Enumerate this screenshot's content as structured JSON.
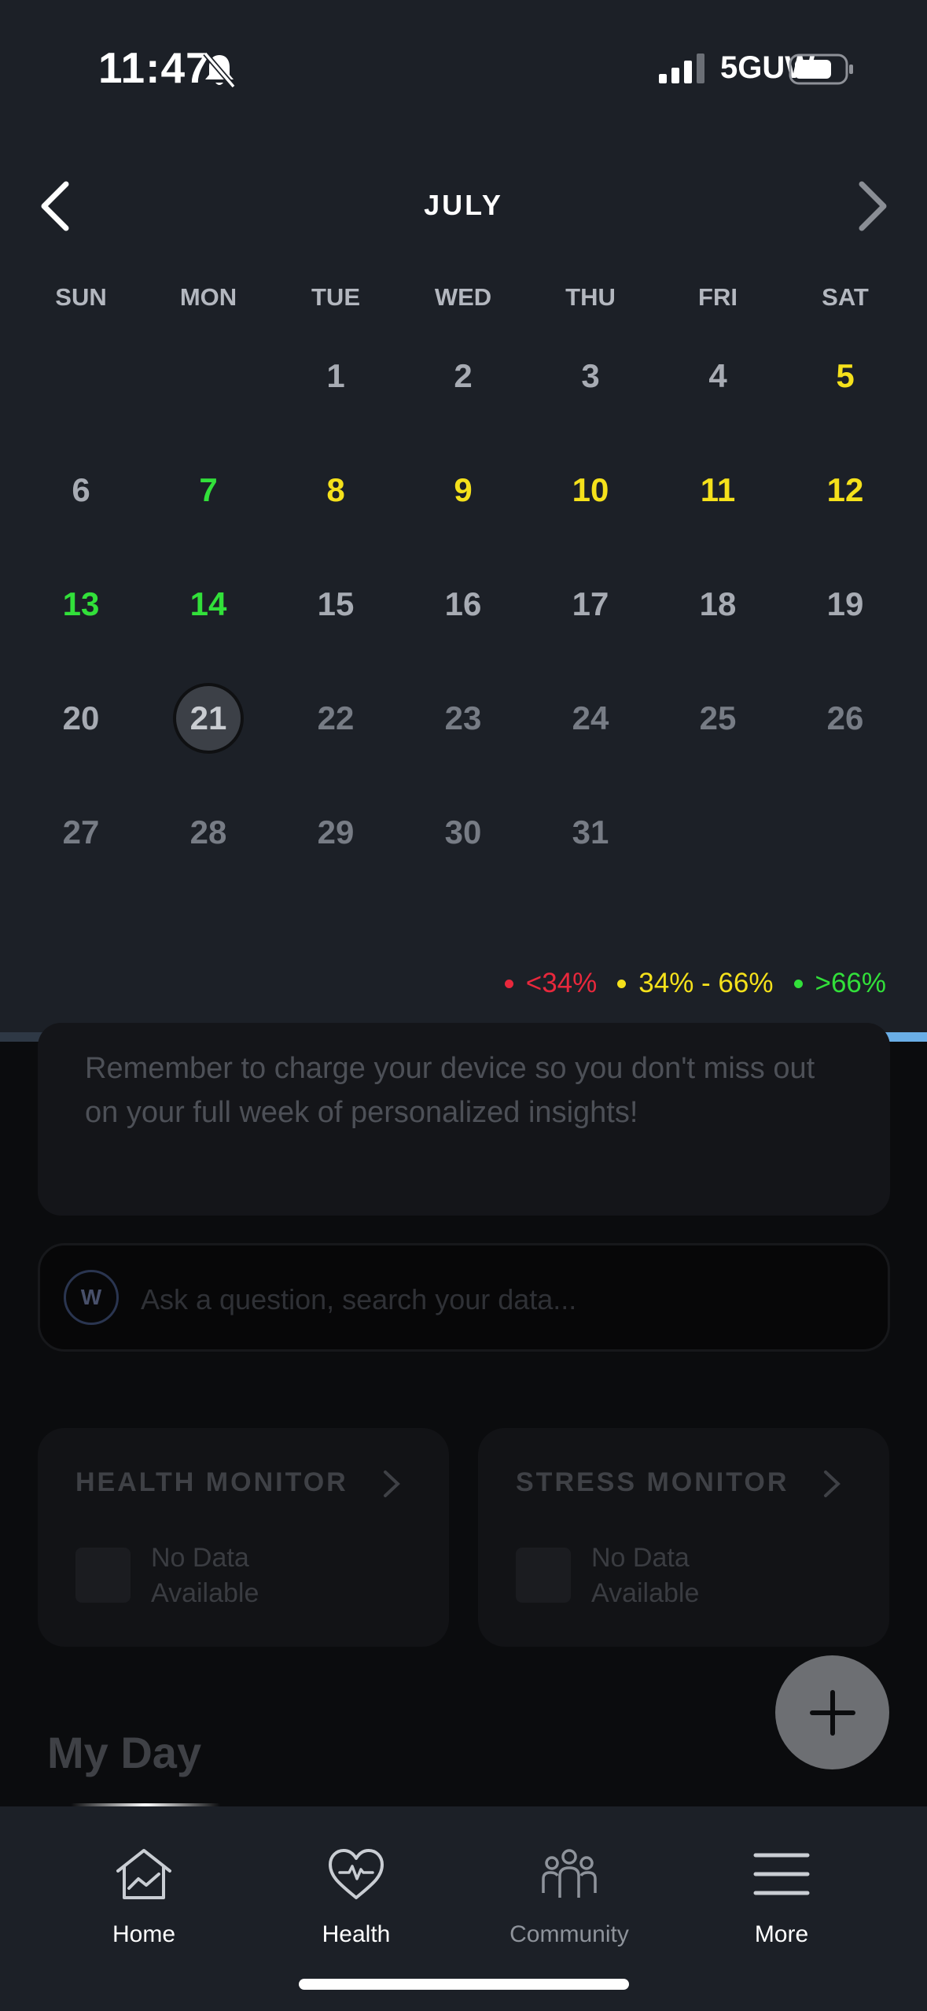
{
  "status_bar": {
    "time": "11:47",
    "network": "5GUW"
  },
  "calendar": {
    "month": "JULY",
    "weekdays": [
      "SUN",
      "MON",
      "TUE",
      "WED",
      "THU",
      "FRI",
      "SAT"
    ],
    "days": [
      {
        "d": "1",
        "s": "past"
      },
      {
        "d": "2",
        "s": "past"
      },
      {
        "d": "3",
        "s": "past"
      },
      {
        "d": "4",
        "s": "past"
      },
      {
        "d": "5",
        "s": "yellow"
      },
      {
        "d": "6",
        "s": "past"
      },
      {
        "d": "7",
        "s": "green"
      },
      {
        "d": "8",
        "s": "yellow"
      },
      {
        "d": "9",
        "s": "yellow"
      },
      {
        "d": "10",
        "s": "yellow"
      },
      {
        "d": "11",
        "s": "yellow"
      },
      {
        "d": "12",
        "s": "yellow"
      },
      {
        "d": "13",
        "s": "green"
      },
      {
        "d": "14",
        "s": "green"
      },
      {
        "d": "15",
        "s": "past"
      },
      {
        "d": "16",
        "s": "past"
      },
      {
        "d": "17",
        "s": "past"
      },
      {
        "d": "18",
        "s": "past"
      },
      {
        "d": "19",
        "s": "past"
      },
      {
        "d": "20",
        "s": "past"
      },
      {
        "d": "21",
        "s": "selected"
      },
      {
        "d": "22",
        "s": "future"
      },
      {
        "d": "23",
        "s": "future"
      },
      {
        "d": "24",
        "s": "future"
      },
      {
        "d": "25",
        "s": "future"
      },
      {
        "d": "26",
        "s": "future"
      },
      {
        "d": "27",
        "s": "future"
      },
      {
        "d": "28",
        "s": "future"
      },
      {
        "d": "29",
        "s": "future"
      },
      {
        "d": "30",
        "s": "future"
      },
      {
        "d": "31",
        "s": "future"
      }
    ],
    "legend": [
      {
        "label": "<34%",
        "color": "#e8283c"
      },
      {
        "label": "34% - 66%",
        "color": "#f5e11b"
      },
      {
        "label": ">66%",
        "color": "#32e03a"
      }
    ],
    "load_progress": 0.86
  },
  "charge_reminder": "Remember to charge your device so you don't miss out on your full week of personalized insights!",
  "ask": {
    "logo": "W",
    "placeholder": "Ask a question, search your data..."
  },
  "monitors": [
    {
      "title": "HEALTH MONITOR",
      "status": "No Data Available"
    },
    {
      "title": "STRESS MONITOR",
      "status": "No Data Available"
    }
  ],
  "my_day_title": "My Day",
  "bottom_nav": {
    "items": [
      {
        "label": "Home",
        "icon": "home-icon"
      },
      {
        "label": "Health",
        "icon": "heart-pulse-icon"
      },
      {
        "label": "Community",
        "icon": "community-icon"
      },
      {
        "label": "More",
        "icon": "menu-icon"
      }
    ]
  }
}
